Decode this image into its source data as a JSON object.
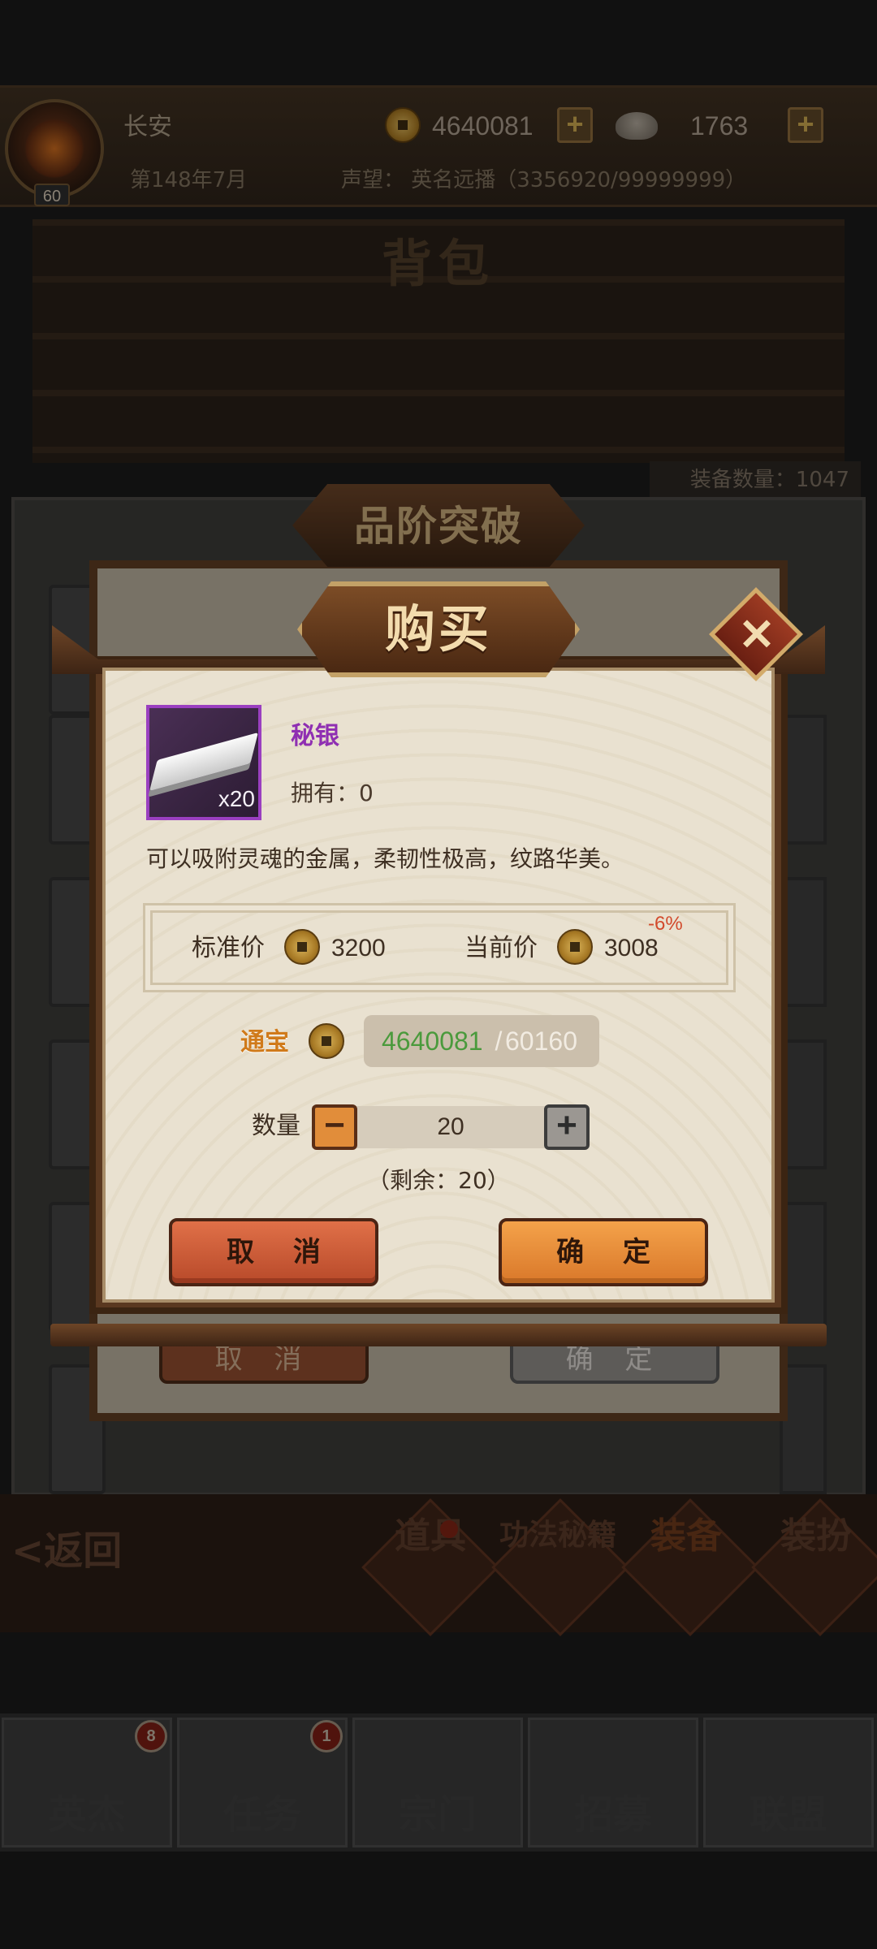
{
  "top_bar": {
    "location": "长安",
    "money": "4640081",
    "ingots": "1763",
    "date": "第148年7月",
    "fame": "声望：  英名远播（3356920/99999999）",
    "level": "60"
  },
  "background": {
    "bag_title": "背包",
    "equip_count": "装备数量：1047",
    "dialog_title": "品阶突破",
    "cancel_label": "取 消",
    "confirm_label": "确 定"
  },
  "sub_nav": {
    "back": "<返回",
    "tabs": [
      "道具",
      "功法秘籍",
      "装备",
      "装扮"
    ]
  },
  "main_nav": {
    "tabs": [
      "英杰",
      "任务",
      "宗门",
      "招募",
      "联盟"
    ],
    "badges": [
      "8",
      "1"
    ]
  },
  "buy_dialog": {
    "title": "购买",
    "item": {
      "name": "秘银",
      "count": "x20",
      "owned": "拥有：0",
      "description": "可以吸附灵魂的金属，柔韧性极高，纹路华美。"
    },
    "price": {
      "standard_label": "标准价",
      "standard_value": "3200",
      "current_label": "当前价",
      "current_value": "3008",
      "discount": "-6%"
    },
    "currency": {
      "label": "通宝",
      "have": "4640081",
      "separator": "/",
      "need": "60160"
    },
    "quantity": {
      "label": "数量",
      "value": "20",
      "remaining": "（剩余：20）"
    },
    "cancel_label": "取 消",
    "confirm_label": "确 定"
  },
  "colors": {
    "accent_orange": "#f4a24a",
    "cancel_red": "#e07048",
    "item_purple": "#8f2fb2",
    "have_green": "#4a9a3c",
    "discount_red": "#d24a2c"
  }
}
